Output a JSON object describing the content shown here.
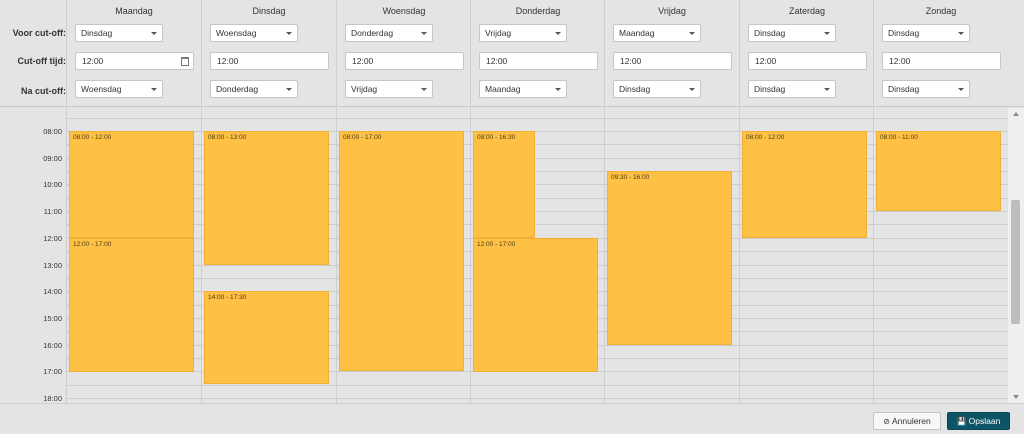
{
  "labels": {
    "before_cutoff": "Voor cut-off:",
    "cutoff_time": "Cut-off tijd:",
    "after_cutoff": "Na cut-off:"
  },
  "days": [
    {
      "name": "Maandag",
      "before": "Dinsdag",
      "time": "12:00",
      "after": "Woensdag"
    },
    {
      "name": "Dinsdag",
      "before": "Woensdag",
      "time": "12:00",
      "after": "Donderdag"
    },
    {
      "name": "Woensdag",
      "before": "Donderdag",
      "time": "12:00",
      "after": "Vrijdag"
    },
    {
      "name": "Donderdag",
      "before": "Vrijdag",
      "time": "12:00",
      "after": "Maandag"
    },
    {
      "name": "Vrijdag",
      "before": "Maandag",
      "time": "12:00",
      "after": "Dinsdag"
    },
    {
      "name": "Zaterdag",
      "before": "Dinsdag",
      "time": "12:00",
      "after": "Dinsdag"
    },
    {
      "name": "Zondag",
      "before": "Dinsdag",
      "time": "12:00",
      "after": "Dinsdag"
    }
  ],
  "times": [
    "08:00",
    "09:00",
    "10:00",
    "11:00",
    "12:00",
    "13:00",
    "14:00",
    "15:00",
    "16:00",
    "17:00",
    "18:00"
  ],
  "slots": [
    {
      "day": 0,
      "start": 8,
      "end": 12,
      "label": "08:00 - 12:00"
    },
    {
      "day": 0,
      "start": 12,
      "end": 17,
      "label": "12:00 - 17:00"
    },
    {
      "day": 1,
      "start": 8,
      "end": 13,
      "label": "08:00 - 13:00"
    },
    {
      "day": 1,
      "start": 14,
      "end": 17.5,
      "label": "14:00 - 17:30"
    },
    {
      "day": 2,
      "start": 8,
      "end": 17,
      "label": "08:00 - 17:00"
    },
    {
      "day": 3,
      "start": 8,
      "end": 12,
      "label": "08:00 - 16:30"
    },
    {
      "day": 3,
      "start": 12,
      "end": 17,
      "label": "12:00 - 17:00"
    },
    {
      "day": 4,
      "start": 9.5,
      "end": 16,
      "label": "09:30 - 16:00"
    },
    {
      "day": 5,
      "start": 8,
      "end": 12,
      "label": "08:00 - 12:00"
    },
    {
      "day": 6,
      "start": 8,
      "end": 11,
      "label": "08:00 - 11:00"
    }
  ],
  "buttons": {
    "cancel": "Annuleren",
    "save": "Opslaan"
  },
  "colors": {
    "slot": "#ffc145",
    "save": "#0d5566"
  }
}
